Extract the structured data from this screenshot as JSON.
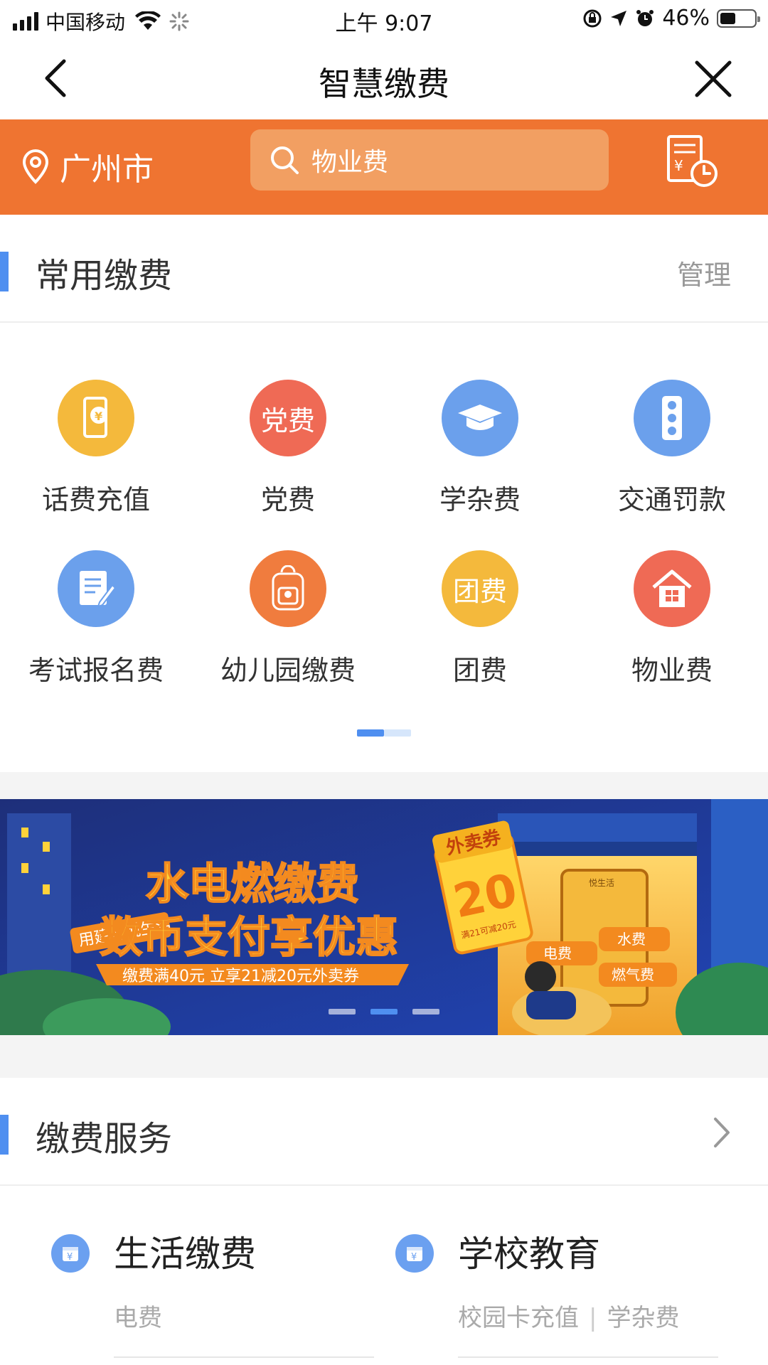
{
  "status_bar": {
    "carrier": "中国移动",
    "time": "上午 9:07",
    "battery_percent": "46%",
    "battery_level": 0.46
  },
  "nav": {
    "title": "智慧缴费",
    "back_icon": "chevron-left-icon",
    "close_icon": "close-icon"
  },
  "header": {
    "city": "广州市",
    "search_placeholder": "物业费",
    "bill_history_icon": "bill-history-icon"
  },
  "common": {
    "title": "常用缴费",
    "manage": "管理",
    "items": [
      {
        "label": "话费充值",
        "icon_text": "",
        "icon": "phone-yuan-icon",
        "color": "#f4b93c"
      },
      {
        "label": "党费",
        "icon_text": "党费",
        "icon": "party-fee-icon",
        "color": "#ef6a55"
      },
      {
        "label": "学杂费",
        "icon_text": "",
        "icon": "graduation-cap-icon",
        "color": "#6ba0ec"
      },
      {
        "label": "交通罚款",
        "icon_text": "",
        "icon": "traffic-light-icon",
        "color": "#6ba0ec"
      },
      {
        "label": "考试报名费",
        "icon_text": "",
        "icon": "exam-form-icon",
        "color": "#6ba0ec"
      },
      {
        "label": "幼儿园缴费",
        "icon_text": "",
        "icon": "school-bag-icon",
        "color": "#f07c3e"
      },
      {
        "label": "团费",
        "icon_text": "团费",
        "icon": "league-fee-icon",
        "color": "#f4b93c"
      },
      {
        "label": "物业费",
        "icon_text": "",
        "icon": "house-icon",
        "color": "#ef6a55"
      }
    ],
    "page_count": 2,
    "current_page": 1
  },
  "banner": {
    "tag": "用建行悦生活",
    "line1": "水电燃缴费",
    "line2": "数币支付享优惠",
    "ribbon": "缴费满40元 立享21减20元外卖券",
    "coupon_label": "外卖券",
    "coupon_value": "20",
    "coupon_note": "满21可减20元",
    "screen_header": "悦生活",
    "fee_electric": "电费",
    "fee_water": "水费",
    "fee_gas": "燃气费",
    "slide_count": 3,
    "current_slide": 2,
    "colors": {
      "bg": "#1b2f86",
      "yellow": "#ffd23a",
      "orange": "#f38a1f"
    }
  },
  "services": {
    "title": "缴费服务",
    "items": [
      {
        "title": "生活缴费",
        "subs": [
          "电费"
        ],
        "icon": "yuan-box-icon"
      },
      {
        "title": "学校教育",
        "subs": [
          "校园卡充值",
          "学杂费"
        ],
        "icon": "yuan-box-icon"
      }
    ]
  },
  "colors": {
    "accent_orange": "#ef7431",
    "accent_blue": "#4f8ff0"
  }
}
